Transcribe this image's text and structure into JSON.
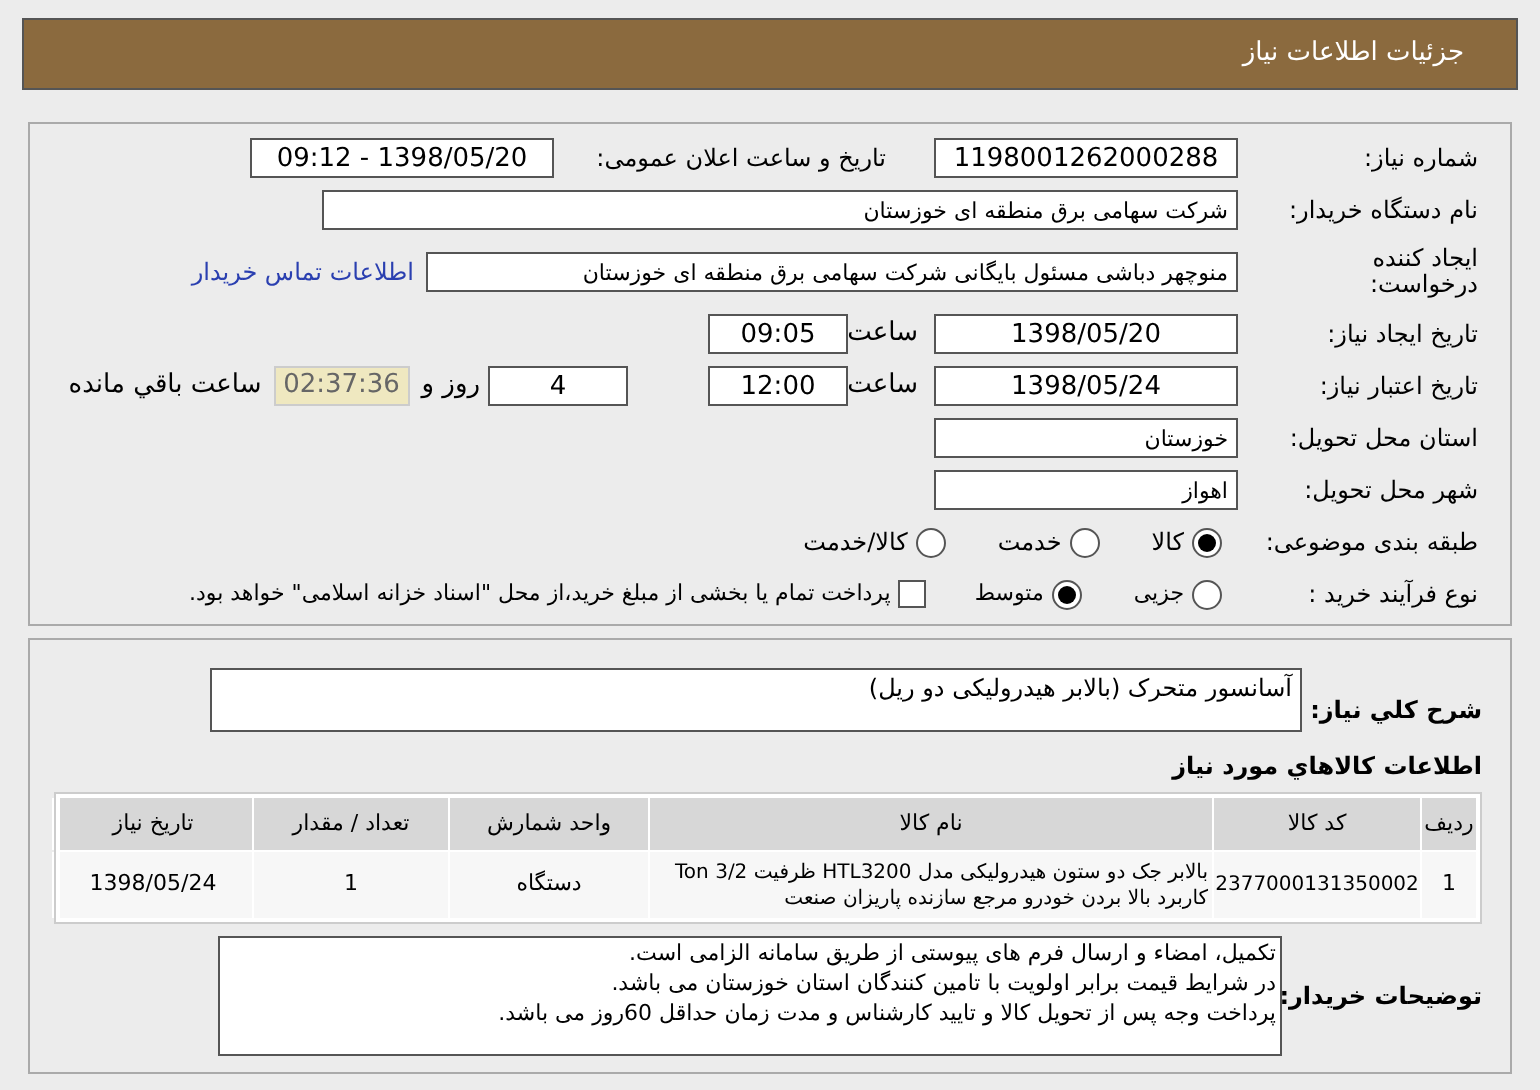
{
  "header": {
    "title": "جزئیات اطلاعات نیاز"
  },
  "details": {
    "need_number": {
      "label": "شماره نیاز:",
      "value": "1198001262000288"
    },
    "announce": {
      "label": "تاریخ و ساعت اعلان عمومی:",
      "value": "1398/05/20 - 09:12"
    },
    "buyer": {
      "label": "نام دستگاه خریدار:",
      "value": "شرکت سهامی برق منطقه ای خوزستان"
    },
    "creator": {
      "label": "ایجاد کننده درخواست:",
      "value": "منوچهر دباشی مسئول بایگانی شرکت سهامی برق منطقه ای خوزستان",
      "link": "اطلاعات تماس خریدار"
    },
    "created": {
      "label": "تاریخ ایجاد نیاز:",
      "date": "1398/05/20",
      "time_label": "ساعت",
      "time": "09:05"
    },
    "validity": {
      "label": "تاریخ اعتبار نیاز:",
      "date": "1398/05/24",
      "time_label": "ساعت",
      "time": "12:00",
      "days": "4",
      "days_label": "روز و",
      "remaining": "02:37:36",
      "remaining_label": "ساعت باقي مانده"
    },
    "province": {
      "label": "استان محل تحویل:",
      "value": "خوزستان"
    },
    "city": {
      "label": "شهر محل تحویل:",
      "value": "اهواز"
    },
    "category": {
      "label": "طبقه بندی موضوعی:",
      "options": [
        {
          "label": "کالا",
          "selected": true
        },
        {
          "label": "خدمت",
          "selected": false
        },
        {
          "label": "کالا/خدمت",
          "selected": false
        }
      ]
    },
    "process": {
      "label": "نوع فرآیند خرید :",
      "options": [
        {
          "label": "جزیی",
          "selected": false
        },
        {
          "label": "متوسط",
          "selected": true
        }
      ],
      "payment": {
        "checked": false,
        "label": "پرداخت تمام یا بخشی از مبلغ خرید،از محل \"اسناد خزانه اسلامی\" خواهد بود."
      }
    }
  },
  "summary": {
    "label": "شرح کلي نياز:",
    "value": "آسانسور متحرک (بالابر هیدرولیکی دو ریل)"
  },
  "goods": {
    "title": "اطلاعات کالاهاي مورد نياز",
    "columns": [
      "ردیف",
      "کد کالا",
      "نام کالا",
      "واحد شمارش",
      "تعداد / مقدار",
      "تاریخ نیاز"
    ],
    "rows": [
      {
        "cells": [
          "1",
          "2377000131350002",
          "بالابر جک دو ستون هیدرولیکی مدل HTL3200 ظرفیت 3/2 Ton کاربرد بالا بردن خودرو مرجع سازنده پاریزان صنعت",
          "دستگاه",
          "1",
          "1398/05/24"
        ]
      }
    ]
  },
  "notes": {
    "label": "توضیحات خریدار:",
    "lines": [
      "تکمیل، امضاء و ارسال فرم های پیوستی از طریق سامانه الزامی است.",
      "در شرایط  قیمت برابر اولویت با تامین کنندگان استان خوزستان می باشد.",
      "پرداخت وجه پس از تحویل کالا و تایید کارشناس و مدت زمان حداقل 60روز می باشد."
    ]
  }
}
